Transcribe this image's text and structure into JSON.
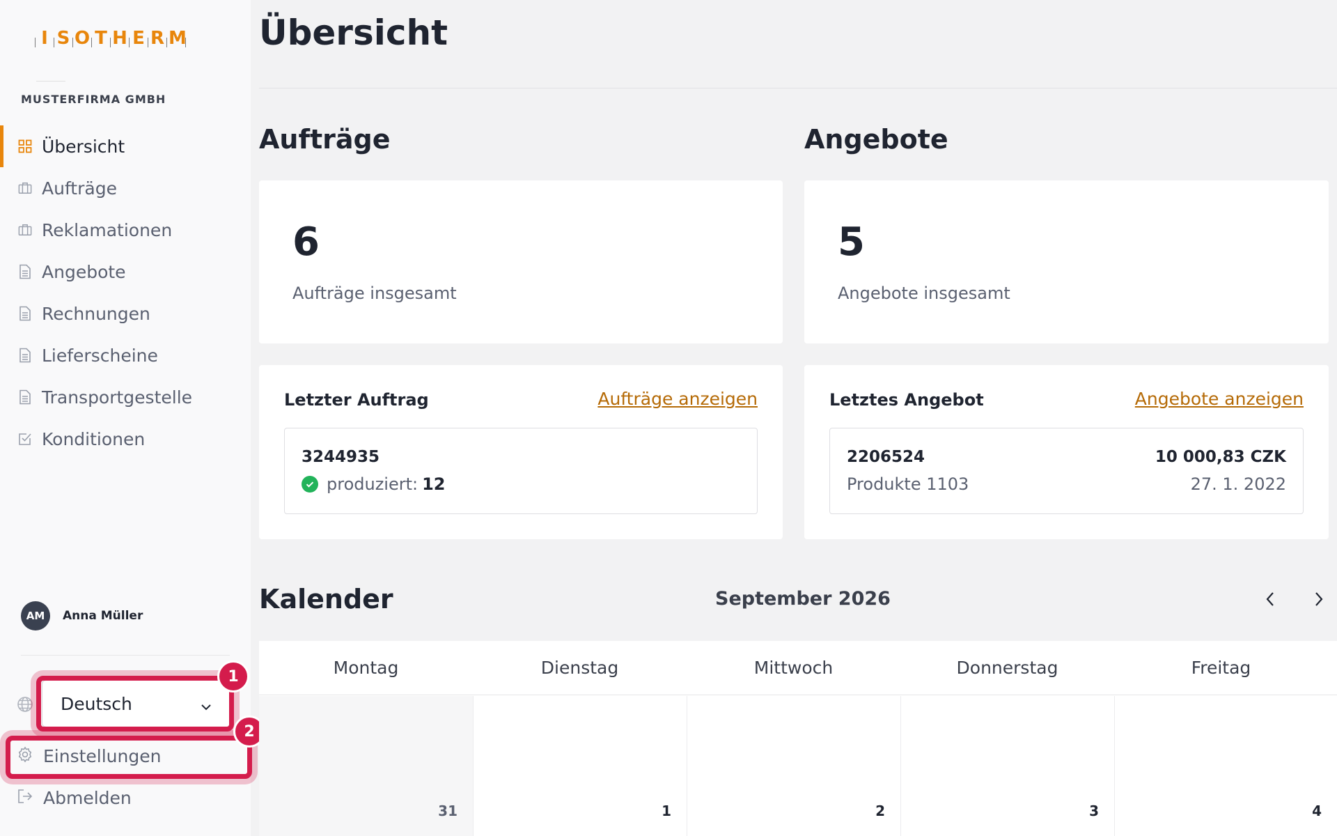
{
  "brand": {
    "logo_letters": [
      "I",
      "S",
      "O",
      "T",
      "H",
      "E",
      "R",
      "M"
    ],
    "company": "MUSTERFIRMA GMBH",
    "accent": "#e8860c"
  },
  "sidebar": {
    "items": [
      {
        "label": "Übersicht",
        "icon": "grid-icon",
        "active": true
      },
      {
        "label": "Aufträge",
        "icon": "briefcase-icon"
      },
      {
        "label": "Reklamationen",
        "icon": "briefcase-icon"
      },
      {
        "label": "Angebote",
        "icon": "document-icon"
      },
      {
        "label": "Rechnungen",
        "icon": "document-icon"
      },
      {
        "label": "Lieferscheine",
        "icon": "document-icon"
      },
      {
        "label": "Transportgestelle",
        "icon": "document-icon"
      },
      {
        "label": "Konditionen",
        "icon": "checkbox-icon"
      }
    ],
    "user": {
      "initials": "AM",
      "name": "Anna Müller"
    },
    "language": {
      "selected": "Deutsch"
    },
    "settings_label": "Einstellungen",
    "logout_label": "Abmelden"
  },
  "callouts": {
    "one": "1",
    "two": "2",
    "color": "#d41c4c"
  },
  "main": {
    "title": "Übersicht",
    "orders": {
      "section_title": "Aufträge",
      "total": "6",
      "total_label": "Aufträge insgesamt",
      "last_title": "Letzter Auftrag",
      "link": "Aufträge anzeigen",
      "last_id": "3244935",
      "status_label": "produziert:",
      "status_value": "12"
    },
    "offers": {
      "section_title": "Angebote",
      "total": "5",
      "total_label": "Angebote insgesamt",
      "last_title": "Letztes Angebot",
      "link": "Angebote anzeigen",
      "last_id": "2206524",
      "products": "Produkte 1103",
      "amount": "10 000,83 CZK",
      "date": "27. 1. 2022"
    },
    "calendar": {
      "title": "Kalender",
      "month": "September 2026",
      "weekdays": [
        "Montag",
        "Dienstag",
        "Mittwoch",
        "Donnerstag",
        "Freitag"
      ],
      "days": [
        "31",
        "1",
        "2",
        "3",
        "4"
      ]
    }
  }
}
